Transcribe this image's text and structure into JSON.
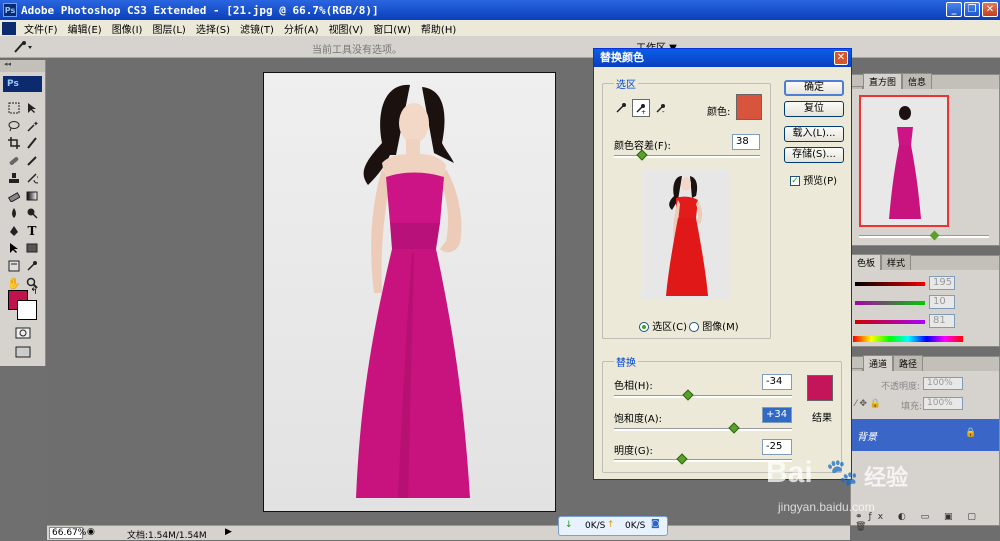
{
  "app": {
    "title": "Adobe Photoshop CS3 Extended - [21.jpg @ 66.7%(RGB/8)]",
    "ps_logo": "Ps"
  },
  "menu": [
    "文件(F)",
    "编辑(E)",
    "图像(I)",
    "图层(L)",
    "选择(S)",
    "滤镜(T)",
    "分析(A)",
    "视图(V)",
    "窗口(W)",
    "帮助(H)"
  ],
  "options_bar": {
    "hint": "当前工具没有选项。",
    "workspace": "工作区 ▼"
  },
  "toolbox": {
    "label": "Ps"
  },
  "status_bar": {
    "zoom": "66.67%",
    "doc": "文档:1.54M/1.54M"
  },
  "net_widget": {
    "down": "0K/S",
    "up": "0K/S"
  },
  "dialog": {
    "title": "替换颜色",
    "selection_group": "选区",
    "color_label": "颜色:",
    "selection_color": "#d9543c",
    "fuzziness_label": "颜色容差(F):",
    "fuzziness_value": "38",
    "fuzziness_level": 38,
    "radio_selection": "选区(C)",
    "radio_image": "图像(M)",
    "replace_group": "替换",
    "hue_label": "色相(H):",
    "hue_value": "-34",
    "saturation_label": "饱和度(A):",
    "saturation_value": "+34",
    "lightness_label": "明度(G):",
    "lightness_value": "-25",
    "result_label": "结果",
    "result_color": "#c4145a",
    "buttons": {
      "ok": "确定",
      "reset": "复位",
      "load": "载入(L)...",
      "save": "存储(S)...",
      "preview": "预览(P)"
    }
  },
  "panels": {
    "navigator_tabs": [
      "直方图",
      "信息"
    ],
    "color_tabs": [
      "色板",
      "样式"
    ],
    "color_values": [
      "195",
      "10",
      "81"
    ],
    "layers_tabs": [
      "通道",
      "路径"
    ],
    "opacity_label": "不透明度:",
    "opacity_value": "100%",
    "fill_label": "填充:",
    "fill_value": "100%",
    "layer_name": "背景"
  },
  "watermark": {
    "brand": "Bai",
    "brand_suffix": "经验",
    "url": "jingyan.baidu.com"
  }
}
